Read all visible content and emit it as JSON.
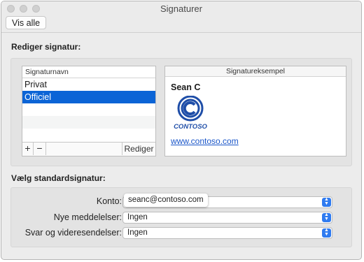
{
  "window": {
    "title": "Signaturer"
  },
  "toolbar": {
    "show_all_label": "Vis alle"
  },
  "edit_section": {
    "title": "Rediger signatur:",
    "list": {
      "header": "Signaturnavn",
      "items": [
        {
          "label": "Privat",
          "selected": false
        },
        {
          "label": "Officiel",
          "selected": true
        }
      ],
      "add_label": "+",
      "remove_label": "−",
      "edit_label": "Rediger"
    },
    "preview": {
      "header": "Signatureksempel",
      "name": "Sean C",
      "logo_text": "CONTOSO",
      "link": "www.contoso.com"
    }
  },
  "default_section": {
    "title": "Vælg standardsignatur:",
    "account_label": "Konto:",
    "account_value": "seanc@contoso.com",
    "new_messages_label": "Nye meddelelser:",
    "new_messages_value": "Ingen",
    "replies_label": "Svar og videresendelser:",
    "replies_value": "Ingen"
  },
  "colors": {
    "selection": "#0b64d6",
    "accent": "#2f7bf0",
    "logo": "#1f4ea8"
  }
}
